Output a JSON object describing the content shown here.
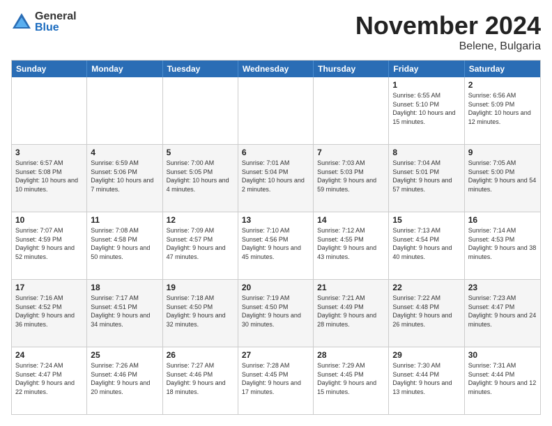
{
  "logo": {
    "general": "General",
    "blue": "Blue"
  },
  "title": "November 2024",
  "location": "Belene, Bulgaria",
  "header_days": [
    "Sunday",
    "Monday",
    "Tuesday",
    "Wednesday",
    "Thursday",
    "Friday",
    "Saturday"
  ],
  "weeks": [
    [
      {
        "day": "",
        "info": ""
      },
      {
        "day": "",
        "info": ""
      },
      {
        "day": "",
        "info": ""
      },
      {
        "day": "",
        "info": ""
      },
      {
        "day": "",
        "info": ""
      },
      {
        "day": "1",
        "info": "Sunrise: 6:55 AM\nSunset: 5:10 PM\nDaylight: 10 hours and 15 minutes."
      },
      {
        "day": "2",
        "info": "Sunrise: 6:56 AM\nSunset: 5:09 PM\nDaylight: 10 hours and 12 minutes."
      }
    ],
    [
      {
        "day": "3",
        "info": "Sunrise: 6:57 AM\nSunset: 5:08 PM\nDaylight: 10 hours and 10 minutes."
      },
      {
        "day": "4",
        "info": "Sunrise: 6:59 AM\nSunset: 5:06 PM\nDaylight: 10 hours and 7 minutes."
      },
      {
        "day": "5",
        "info": "Sunrise: 7:00 AM\nSunset: 5:05 PM\nDaylight: 10 hours and 4 minutes."
      },
      {
        "day": "6",
        "info": "Sunrise: 7:01 AM\nSunset: 5:04 PM\nDaylight: 10 hours and 2 minutes."
      },
      {
        "day": "7",
        "info": "Sunrise: 7:03 AM\nSunset: 5:03 PM\nDaylight: 9 hours and 59 minutes."
      },
      {
        "day": "8",
        "info": "Sunrise: 7:04 AM\nSunset: 5:01 PM\nDaylight: 9 hours and 57 minutes."
      },
      {
        "day": "9",
        "info": "Sunrise: 7:05 AM\nSunset: 5:00 PM\nDaylight: 9 hours and 54 minutes."
      }
    ],
    [
      {
        "day": "10",
        "info": "Sunrise: 7:07 AM\nSunset: 4:59 PM\nDaylight: 9 hours and 52 minutes."
      },
      {
        "day": "11",
        "info": "Sunrise: 7:08 AM\nSunset: 4:58 PM\nDaylight: 9 hours and 50 minutes."
      },
      {
        "day": "12",
        "info": "Sunrise: 7:09 AM\nSunset: 4:57 PM\nDaylight: 9 hours and 47 minutes."
      },
      {
        "day": "13",
        "info": "Sunrise: 7:10 AM\nSunset: 4:56 PM\nDaylight: 9 hours and 45 minutes."
      },
      {
        "day": "14",
        "info": "Sunrise: 7:12 AM\nSunset: 4:55 PM\nDaylight: 9 hours and 43 minutes."
      },
      {
        "day": "15",
        "info": "Sunrise: 7:13 AM\nSunset: 4:54 PM\nDaylight: 9 hours and 40 minutes."
      },
      {
        "day": "16",
        "info": "Sunrise: 7:14 AM\nSunset: 4:53 PM\nDaylight: 9 hours and 38 minutes."
      }
    ],
    [
      {
        "day": "17",
        "info": "Sunrise: 7:16 AM\nSunset: 4:52 PM\nDaylight: 9 hours and 36 minutes."
      },
      {
        "day": "18",
        "info": "Sunrise: 7:17 AM\nSunset: 4:51 PM\nDaylight: 9 hours and 34 minutes."
      },
      {
        "day": "19",
        "info": "Sunrise: 7:18 AM\nSunset: 4:50 PM\nDaylight: 9 hours and 32 minutes."
      },
      {
        "day": "20",
        "info": "Sunrise: 7:19 AM\nSunset: 4:50 PM\nDaylight: 9 hours and 30 minutes."
      },
      {
        "day": "21",
        "info": "Sunrise: 7:21 AM\nSunset: 4:49 PM\nDaylight: 9 hours and 28 minutes."
      },
      {
        "day": "22",
        "info": "Sunrise: 7:22 AM\nSunset: 4:48 PM\nDaylight: 9 hours and 26 minutes."
      },
      {
        "day": "23",
        "info": "Sunrise: 7:23 AM\nSunset: 4:47 PM\nDaylight: 9 hours and 24 minutes."
      }
    ],
    [
      {
        "day": "24",
        "info": "Sunrise: 7:24 AM\nSunset: 4:47 PM\nDaylight: 9 hours and 22 minutes."
      },
      {
        "day": "25",
        "info": "Sunrise: 7:26 AM\nSunset: 4:46 PM\nDaylight: 9 hours and 20 minutes."
      },
      {
        "day": "26",
        "info": "Sunrise: 7:27 AM\nSunset: 4:46 PM\nDaylight: 9 hours and 18 minutes."
      },
      {
        "day": "27",
        "info": "Sunrise: 7:28 AM\nSunset: 4:45 PM\nDaylight: 9 hours and 17 minutes."
      },
      {
        "day": "28",
        "info": "Sunrise: 7:29 AM\nSunset: 4:45 PM\nDaylight: 9 hours and 15 minutes."
      },
      {
        "day": "29",
        "info": "Sunrise: 7:30 AM\nSunset: 4:44 PM\nDaylight: 9 hours and 13 minutes."
      },
      {
        "day": "30",
        "info": "Sunrise: 7:31 AM\nSunset: 4:44 PM\nDaylight: 9 hours and 12 minutes."
      }
    ]
  ]
}
